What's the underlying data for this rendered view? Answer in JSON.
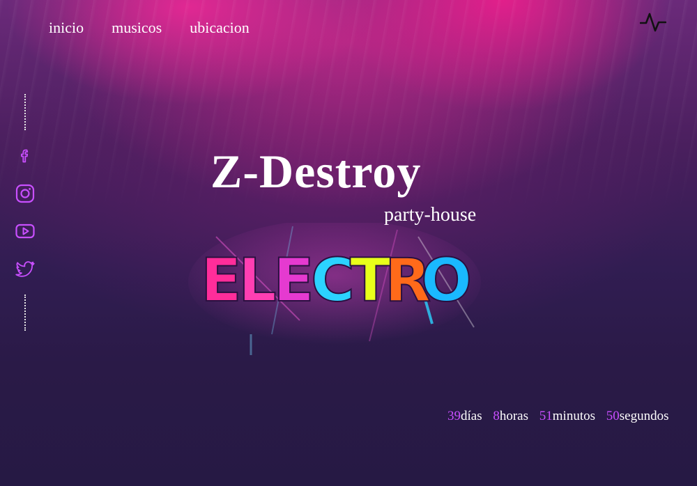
{
  "nav": {
    "items": [
      {
        "label": "inicio"
      },
      {
        "label": "musicos"
      },
      {
        "label": "ubicacion"
      }
    ]
  },
  "header": {
    "pulse_icon": "activity-pulse-icon"
  },
  "social": {
    "icons": [
      "facebook-icon",
      "instagram-icon",
      "youtube-icon",
      "twitter-icon"
    ],
    "color": "#c94fff"
  },
  "hero": {
    "title": "Z-Destroy",
    "subtitle": "party-house",
    "logo_text": "ELECTRO",
    "logo_colors": [
      "#ff2d9a",
      "#ff3fb2",
      "#e53ad0",
      "#b26bff",
      "#2bd3ff",
      "#e9ff1a",
      "#ff6a1a",
      "#1ab9ff"
    ]
  },
  "countdown": {
    "days": "39",
    "days_label": "días",
    "hours": "8",
    "hours_label": "horas",
    "minutes": "51",
    "minutes_label": "minutos",
    "seconds": "50",
    "seconds_label": "segundos"
  }
}
